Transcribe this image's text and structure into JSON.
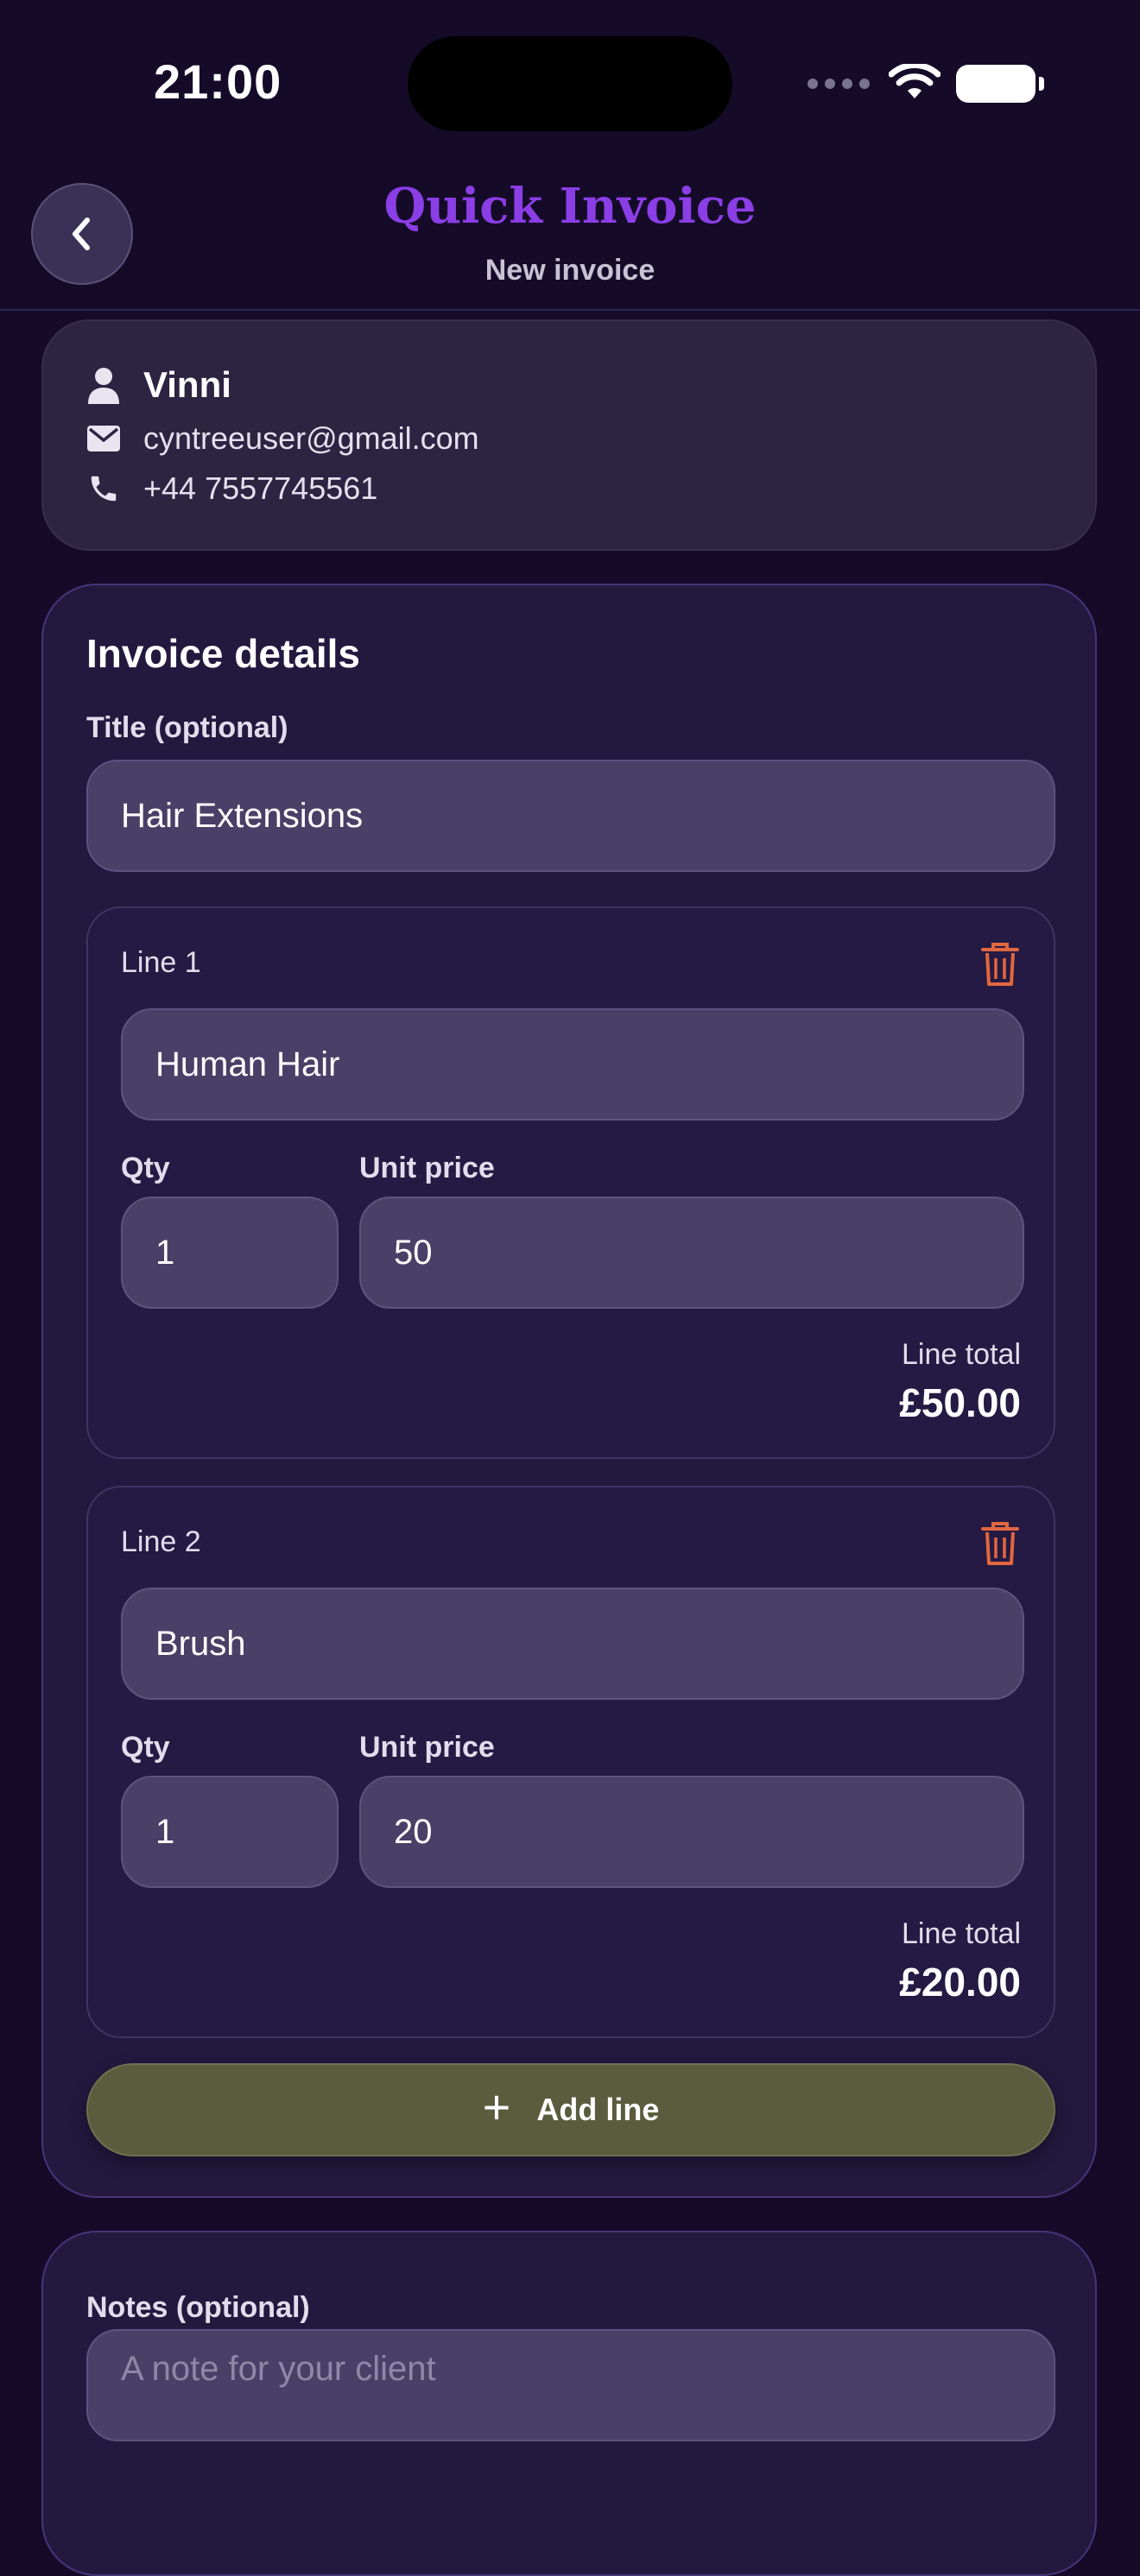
{
  "status_bar": {
    "time": "21:00"
  },
  "header": {
    "title": "Quick Invoice",
    "subtitle": "New invoice"
  },
  "client": {
    "name": "Vinni",
    "email": "cyntreeuser@gmail.com",
    "phone": "+44 7557745561"
  },
  "invoice": {
    "section_title": "Invoice details",
    "title_label": "Title (optional)",
    "title_value": "Hair Extensions",
    "qty_label": "Qty",
    "unit_price_label": "Unit price",
    "line_total_label": "Line total",
    "lines": [
      {
        "label": "Line 1",
        "description": "Human Hair",
        "qty": "1",
        "unit_price": "50",
        "line_total": "£50.00"
      },
      {
        "label": "Line 2",
        "description": "Brush",
        "qty": "1",
        "unit_price": "20",
        "line_total": "£20.00"
      }
    ],
    "add_line_label": "Add line"
  },
  "notes": {
    "label": "Notes (optional)",
    "placeholder": "A note for your client"
  },
  "colors": {
    "background": "#150b29",
    "accent_title": "#8b3ee6",
    "trash": "#e2673f",
    "add_button": "#5a5c3d"
  }
}
